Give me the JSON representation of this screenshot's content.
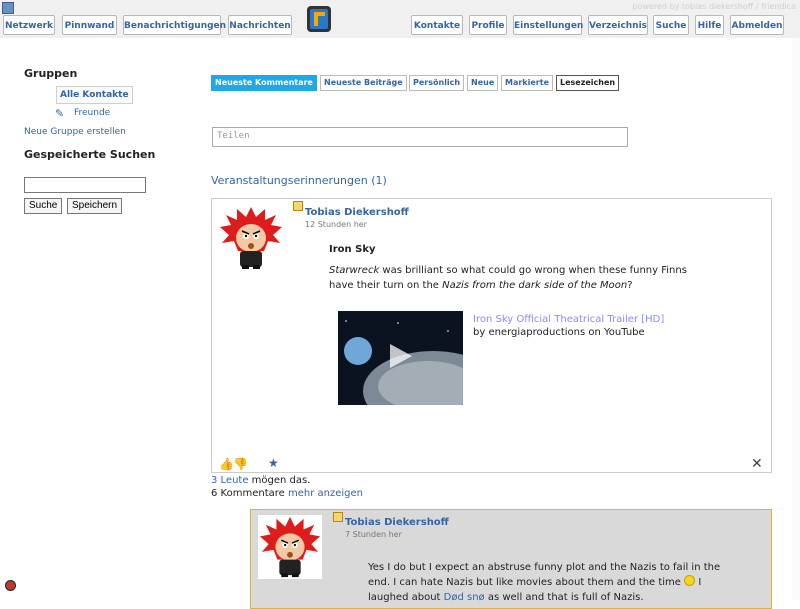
{
  "nav": {
    "left": [
      "Netzwerk",
      "Pinnwand",
      "Benachrichtigungen",
      "Nachrichten"
    ],
    "right": [
      "Kontakte",
      "Profile",
      "Einstellungen",
      "Verzeichnis",
      "Suche",
      "Hilfe",
      "Abmelden"
    ]
  },
  "banner": "powered by tobias diekershoff / friendica",
  "sidebar": {
    "groups_title": "Gruppen",
    "all_contacts": "Alle Kontakte",
    "group_freunde": "Freunde",
    "new_group": "Neue Gruppe erstellen",
    "saved_title": "Gespeicherte Suchen",
    "search_btn": "Suche",
    "save_btn": "Speichern"
  },
  "tabs": [
    "Neueste Kommentare",
    "Neueste Beiträge",
    "Persönlich",
    "Neue",
    "Markierte",
    "Lesezeichen"
  ],
  "share_placeholder": "Teilen",
  "event_reminders": "Veranstaltungserinnerungen (1)",
  "post": {
    "author": "Tobias Diekershoff",
    "time": "12 Stunden her",
    "title": "Iron Sky",
    "body_em1": "Starwreck",
    "body_t1": " was brilliant so what could go wrong when these funny Finns have their turn on the ",
    "body_em2": "Nazis from the dark side of the Moon",
    "body_t2": "?",
    "video_title": "Iron Sky Official Theatrical Trailer [HD]",
    "video_by": "by energiaproductions on YouTube",
    "likes_link": "3 Leute",
    "likes_text": " mögen das.",
    "comments_text": "6 Kommentare ",
    "comments_more": "mehr anzeigen"
  },
  "comment": {
    "author": "Tobias Diekershoff",
    "time": "7 Stunden her",
    "text_1": "Yes I do but I expect an abstruse funny plot and the Nazis to fail in the end. I can hate Nazis but like movies about them and the time ",
    "text_2": " I laughed about ",
    "link": "Død snø",
    "text_3": " as well and that is full of Nazis."
  }
}
